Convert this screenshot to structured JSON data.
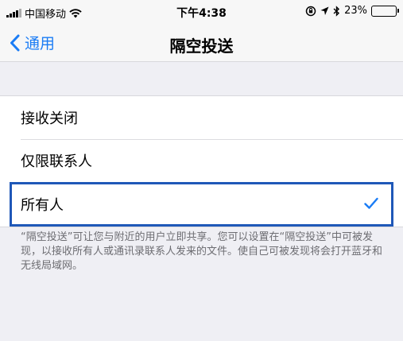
{
  "status_bar": {
    "carrier": "中国移动",
    "time": "下午4:38",
    "battery_percent": "23%",
    "battery_level": 0.23
  },
  "nav": {
    "back_label": "通用",
    "title": "隔空投送"
  },
  "options": [
    {
      "label": "接收关闭",
      "selected": false
    },
    {
      "label": "仅限联系人",
      "selected": false
    },
    {
      "label": "所有人",
      "selected": true
    }
  ],
  "footer_note": "“隔空投送”可让您与附近的用户立即共享。您可以设置在“隔空投送”中可被发现，以接收所有人或通讯录联系人发来的文件。使自己可被发现将会打开蓝牙和无线局域网。",
  "colors": {
    "accent": "#1a7cf5",
    "highlight_border": "#1f58b8"
  },
  "icons": [
    "signal-icon",
    "wifi-icon",
    "lock-rotation-icon",
    "location-icon",
    "bluetooth-icon",
    "battery-icon",
    "back-chevron-icon",
    "checkmark-icon"
  ]
}
